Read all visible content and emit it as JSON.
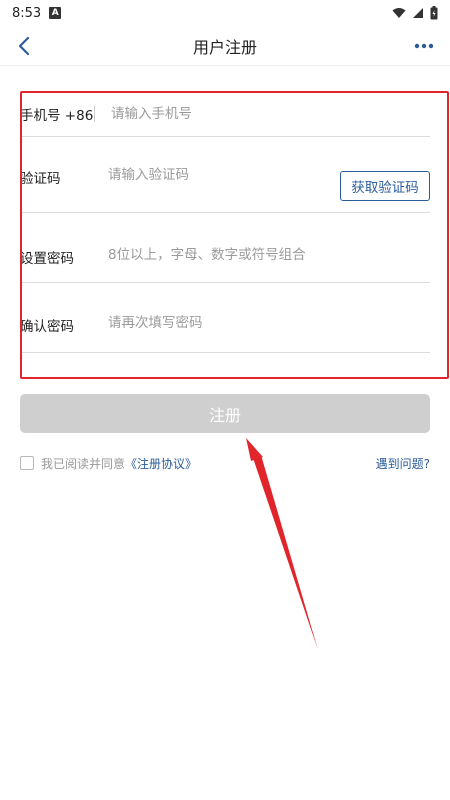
{
  "status_bar": {
    "time": "8:53",
    "notification_badge": "A"
  },
  "header": {
    "title": "用户注册"
  },
  "form": {
    "phone": {
      "label": "手机号 +86",
      "placeholder": "请输入手机号"
    },
    "code": {
      "label": "验证码",
      "placeholder": "请输入验证码",
      "button_label": "获取验证码"
    },
    "password": {
      "label": "设置密码",
      "placeholder": "8位以上，字母、数字或符号组合"
    },
    "confirm": {
      "label": "确认密码",
      "placeholder": "请再次填写密码"
    }
  },
  "register_label": "注册",
  "agreement": {
    "prefix": "我已阅读并同意",
    "link_label": "《注册协议》"
  },
  "help_label": "遇到问题?",
  "colors": {
    "accent": "#2a5c9a",
    "annotation_red": "#e1262b",
    "disabled_button": "#cfcfcf"
  }
}
